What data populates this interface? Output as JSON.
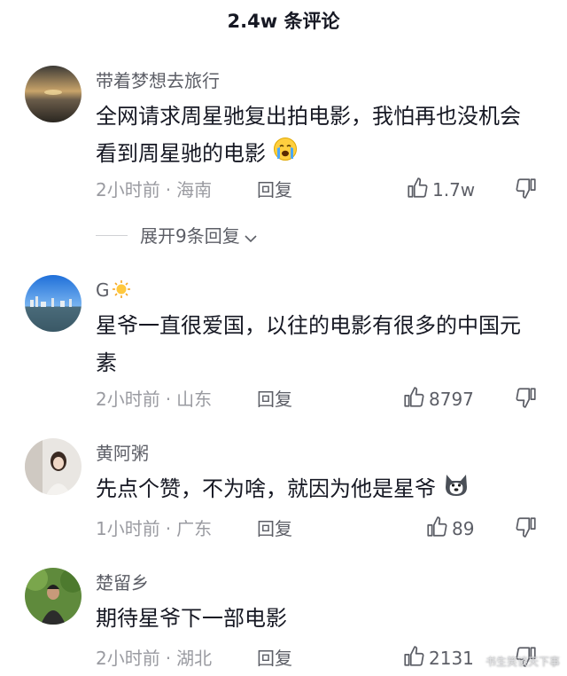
{
  "header": {
    "title": "2.4w 条评论"
  },
  "comments": [
    {
      "username": "带着梦想去旅行",
      "content": "全网请求周星驰复出拍电影，我怕再也没机会看到周星驰的电影",
      "emoji": "crying-face-icon",
      "time": "2小时前",
      "location": "海南",
      "reply_label": "回复",
      "likes": "1.7w"
    },
    {
      "username": "G",
      "username_emoji": "sun-icon",
      "content": "星爷一直很爱国，以往的电影有很多的中国元素",
      "time": "2小时前",
      "location": "山东",
      "reply_label": "回复",
      "likes": "8797"
    },
    {
      "username": "黄阿粥",
      "content": "先点个赞，不为啥，就因为他是星爷",
      "emoji": "husky-dog-icon",
      "time": "1小时前",
      "location": "广东",
      "reply_label": "回复",
      "likes": "89"
    },
    {
      "username": "楚留乡",
      "content": "期待星爷下一部电影",
      "time": "2小时前",
      "location": "湖北",
      "reply_label": "回复",
      "likes": "2131"
    }
  ],
  "expand_replies": {
    "label": "展开9条回复"
  },
  "separator": "·",
  "watermark": "书生笑谈天下事",
  "colors": {
    "text": "#161823",
    "secondary": "#9a9ba1",
    "accent_text": "#5c5e66"
  }
}
